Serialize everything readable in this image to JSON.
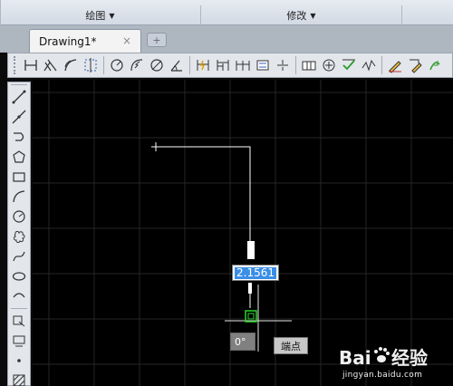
{
  "ribbon": {
    "panels": [
      {
        "label": "绘图",
        "caret": "▼"
      },
      {
        "label": "修改",
        "caret": "▼"
      }
    ]
  },
  "tabs": {
    "document_tab": "Drawing1*",
    "close_glyph": "×",
    "new_tab_glyph": "+"
  },
  "toolbar": {
    "icons": [
      "linear-dim-icon",
      "aligned-dim-icon",
      "arc-length-dim-icon",
      "ordinate-dim-icon",
      "radius-dim-icon",
      "jogged-dim-icon",
      "diameter-dim-icon",
      "angular-dim-icon",
      "quick-dim-icon",
      "baseline-dim-icon",
      "continue-dim-icon",
      "dim-space-icon",
      "dim-break-icon",
      "tolerance-icon",
      "center-mark-icon",
      "inspect-icon",
      "jogged-linear-icon",
      "dim-edit-icon",
      "dim-text-edit-icon"
    ]
  },
  "draw_tools": [
    "line-icon",
    "construction-line-icon",
    "polyline-icon",
    "polygon-icon",
    "rectangle-icon",
    "arc-icon",
    "circle-icon",
    "revcloud-icon",
    "spline-icon",
    "ellipse-icon",
    "ellipse-arc-icon",
    "insert-block-icon",
    "make-block-icon",
    "point-icon",
    "hatch-icon"
  ],
  "canvas": {
    "dynamic_input_value": "2.1561",
    "angle_value": "0°",
    "snap_tooltip": "端点",
    "background": "#000000",
    "grid_color": "#262626",
    "line_color": "#ffffff",
    "snap_marker_color": "#2bd42b",
    "input_highlight": "#3a8ee6"
  },
  "watermark": {
    "logo_text": "Bai du 经验",
    "url": "jingyan.baidu.com"
  }
}
